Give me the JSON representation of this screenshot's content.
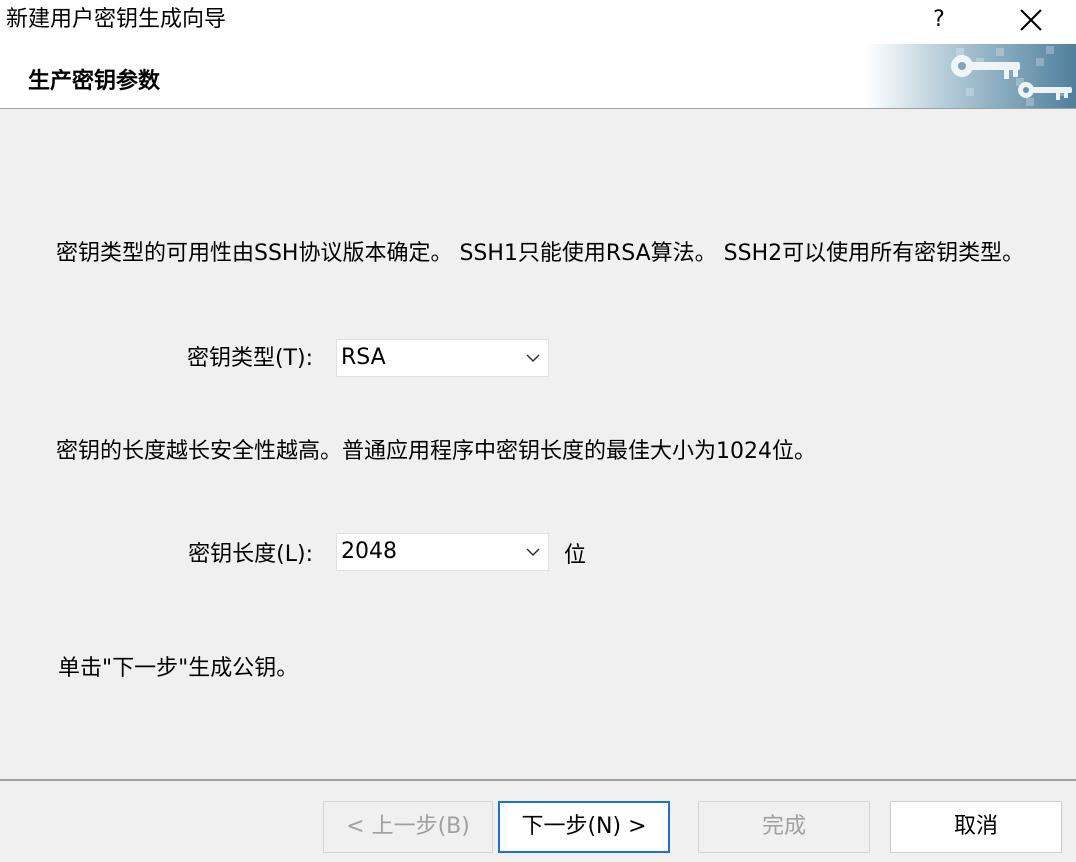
{
  "window": {
    "title": "新建用户密钥生成向导",
    "help_label": "?",
    "close_icon": "close-icon"
  },
  "header": {
    "title": "生产密钥参数",
    "banner_icon": "keys-banner-icon"
  },
  "content": {
    "key_type_description": "密钥类型的可用性由SSH协议版本确定。 SSH1只能使用RSA算法。 SSH2可以使用所有密钥类型。",
    "key_type_label": "密钥类型(T):",
    "key_type_value": "RSA",
    "key_length_description": "密钥的长度越长安全性越高。普通应用程序中密钥长度的最佳大小为1024位。",
    "key_length_label": "密钥长度(L):",
    "key_length_value": "2048",
    "key_length_unit": "位",
    "instruction": "单击\"下一步\"生成公钥。"
  },
  "buttons": {
    "back": "< 上一步(B)",
    "next": "下一步(N) >",
    "finish": "完成",
    "cancel": "取消"
  },
  "colors": {
    "accent": "#1b73cf",
    "disabled_text": "#a0a0a0",
    "dialog_bg": "#f0f0f0"
  }
}
